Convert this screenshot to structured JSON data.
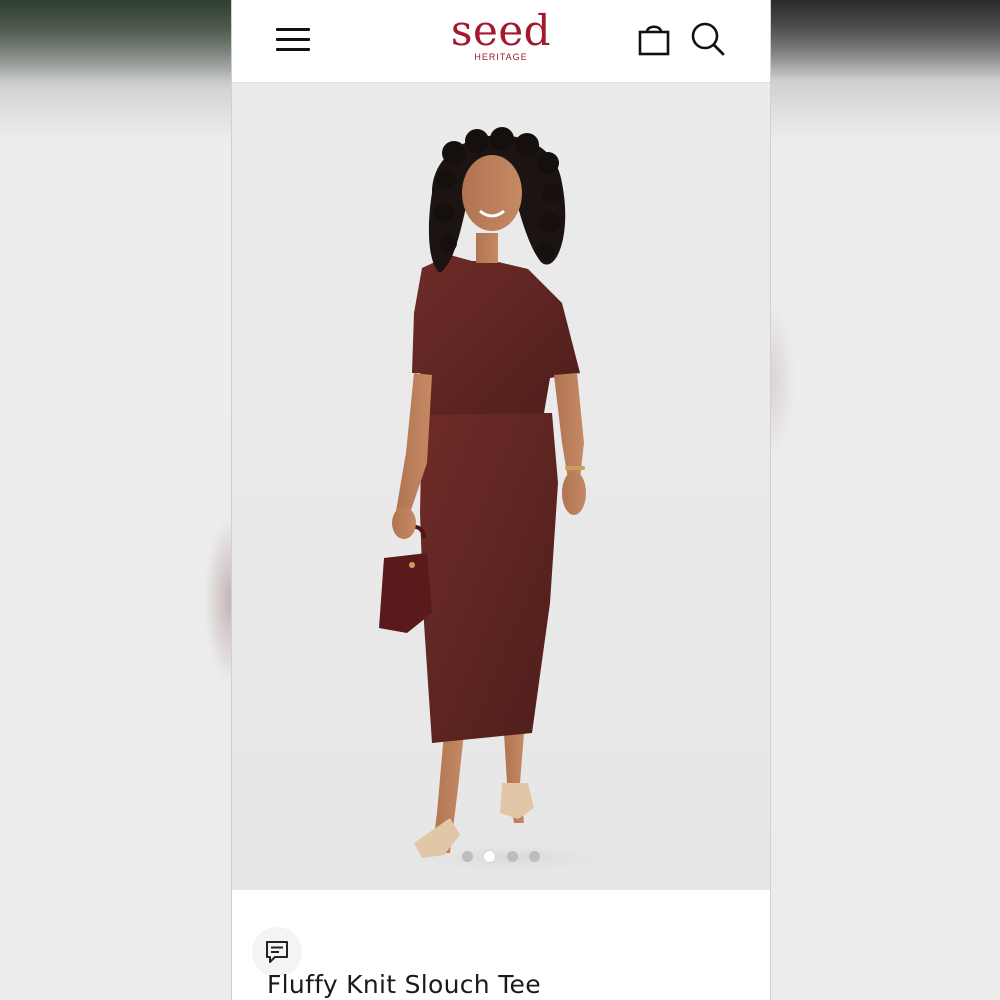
{
  "header": {
    "menu_icon": "hamburger-menu-icon",
    "logo_wordmark": "seed",
    "logo_subtitle": "HERITAGE",
    "brand_color": "#a3182d",
    "bag_icon": "shopping-bag-icon",
    "search_icon": "search-icon"
  },
  "gallery": {
    "image_alt": "Model wearing burgundy knit tee and skirt",
    "dot_count": 4,
    "active_dot_index": 1
  },
  "product": {
    "chat_icon": "chat-bubble-icon",
    "title": "Fluffy Knit Slouch Tee"
  }
}
